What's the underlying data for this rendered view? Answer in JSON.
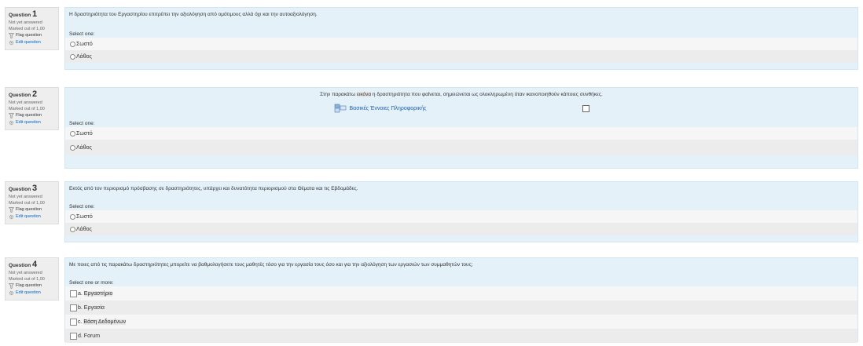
{
  "common": {
    "status": "Not yet answered",
    "marked": "Marked out of 1,00",
    "flag": "Flag question",
    "edit": "Edit question",
    "select_one": "Select one:",
    "select_more": "Select one or more:"
  },
  "questions": [
    {
      "label": "Question",
      "number": "1",
      "text": "Η δραστηριότητα του Εργαστηρίου επιτρέπει την αξιολόγηση από ομότιμους αλλά όχι και την αυτοαξιολόγηση.",
      "options": [
        "Σωστό",
        "Λάθος"
      ]
    },
    {
      "label": "Question",
      "number": "2",
      "text_before": "Στην παρακάτω ",
      "text_highlight": "εικόνα",
      "text_after": " η δραστηριότητα που φαίνεται, σημειώνεται ως ολοκληρωμένη όταν ικανοποιηθούν κάποιες συνθήκες.",
      "course_name": "Βασικές Έννοιες Πληροφορικής",
      "options": [
        "Σωστό",
        "Λάθος"
      ]
    },
    {
      "label": "Question",
      "number": "3",
      "text": "Εκτός από τον περιορισμό πρόσβασης σε δραστηριότητες, υπάρχει και δυνατότητα περιορισμού στα Θέματα και τις Εβδομάδες.",
      "options": [
        "Σωστό",
        "Λάθος"
      ]
    },
    {
      "label": "Question",
      "number": "4",
      "text": "Με ποιες από τις παρακάτω δραστηριότητες μπορείτε να βαθμολογήσετε τους μαθητές τόσο για την εργασία τους όσο και για την αξιολόγηση των εργασιών των συμμαθητών τους;",
      "options": [
        {
          "prefix": "a. ",
          "label": "Εργαστήριο"
        },
        {
          "prefix": "b. ",
          "label": "Εργασία"
        },
        {
          "prefix": "c. ",
          "label": "Βάση Δεδομένων"
        },
        {
          "prefix": "d. ",
          "label": "Forum"
        }
      ]
    }
  ]
}
